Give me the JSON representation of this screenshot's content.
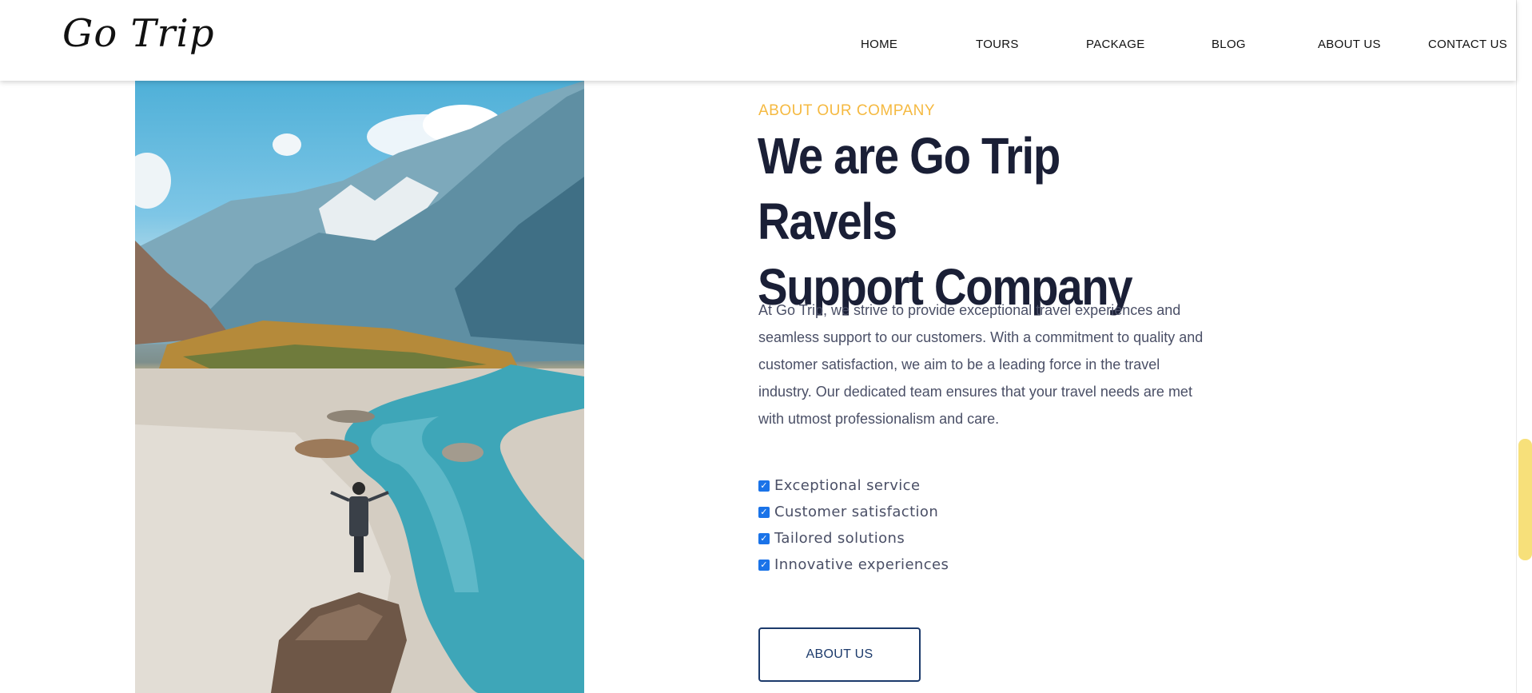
{
  "header": {
    "logo": "Go Trip",
    "nav": [
      {
        "label": "HOME"
      },
      {
        "label": "TOURS"
      },
      {
        "label": "PACKAGE"
      },
      {
        "label": "BLOG"
      },
      {
        "label": "ABOUT US"
      },
      {
        "label": "CONTACT US"
      }
    ]
  },
  "about": {
    "eyebrow": "ABOUT OUR COMPANY",
    "headline_line1": "We are Go Trip Ravels",
    "headline_line2": "Support Company",
    "description": "At Go Trip, we strive to provide exceptional travel experiences and seamless support to our customers. With a commitment to quality and customer satisfaction, we aim to be a leading force in the travel industry. Our dedicated team ensures that your travel needs are met with utmost professionalism and care.",
    "features": [
      {
        "label": "Exceptional service",
        "checked": true
      },
      {
        "label": "Customer satisfaction",
        "checked": true
      },
      {
        "label": "Tailored solutions",
        "checked": true
      },
      {
        "label": "Innovative experiences",
        "checked": true
      }
    ],
    "button_label": "ABOUT US"
  },
  "colors": {
    "accent": "#f5b940",
    "heading": "#1a1f36",
    "body": "#4a4f66",
    "button_border": "#1c3a6b",
    "checkbox": "#1a73e8",
    "scroll_thumb": "#f7e07a"
  },
  "icons": {
    "checkbox": "checkmark-icon"
  }
}
